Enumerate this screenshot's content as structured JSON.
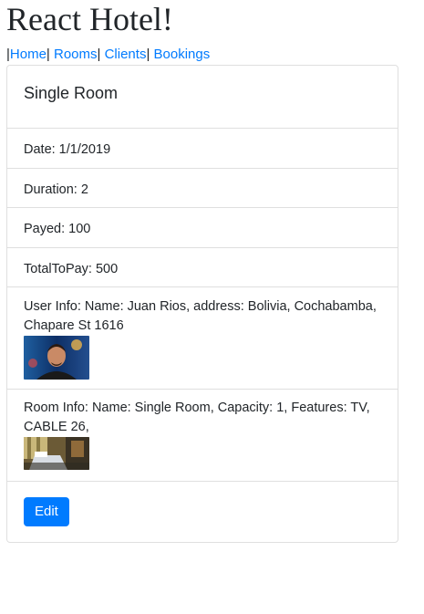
{
  "app": {
    "title": "React Hotel!"
  },
  "nav": {
    "separator": "|",
    "links": [
      "Home",
      "Rooms",
      "Clients",
      "Bookings"
    ]
  },
  "booking": {
    "header": "Single Room",
    "date": "Date: 1/1/2019",
    "duration": "Duration: 2",
    "payed": "Payed: 100",
    "total": "TotalToPay: 500",
    "user_info": "User Info: Name: Juan Rios, address: Bolivia, Cochabamba, Chapare St 1616",
    "room_info": "Room Info: Name: Single Room, Capacity: 1, Features: TV, CABLE 26,",
    "edit_label": "Edit"
  },
  "colors": {
    "link": "#007bff",
    "button": "#007bff",
    "border": "#dfdfdf"
  }
}
